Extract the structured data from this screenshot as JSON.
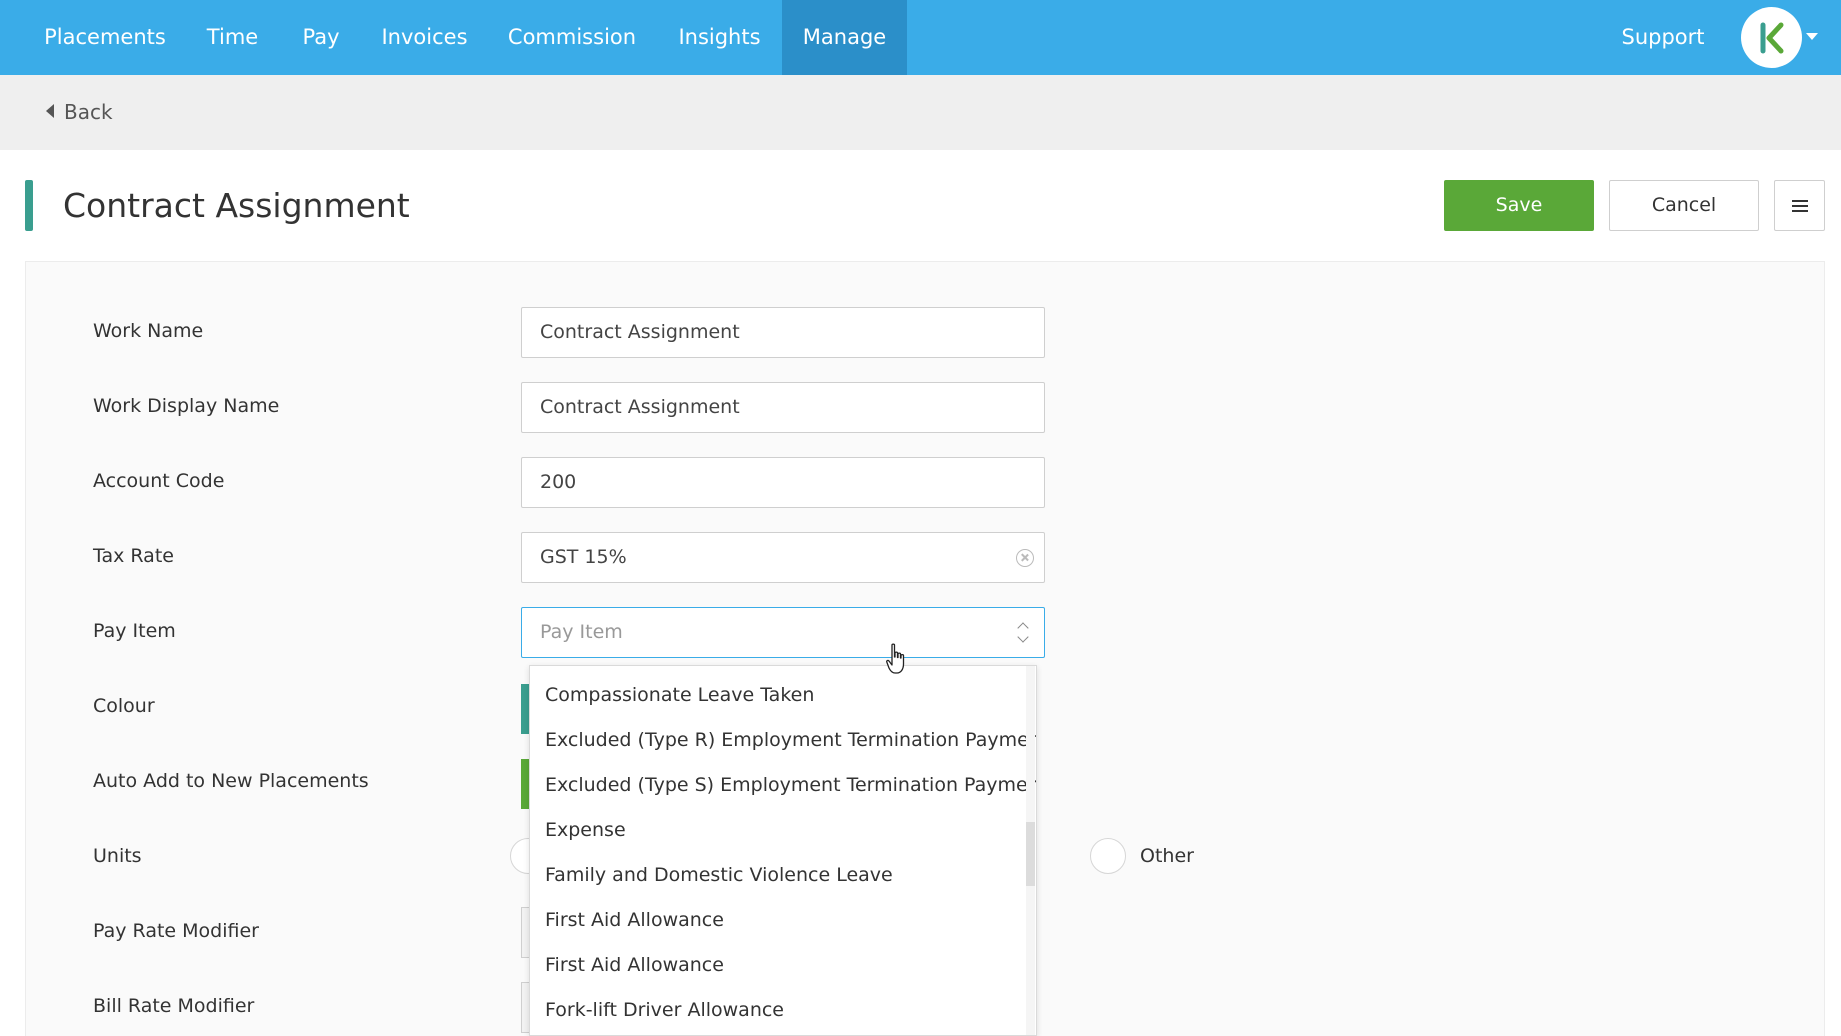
{
  "nav": {
    "items": [
      {
        "label": "Placements"
      },
      {
        "label": "Time"
      },
      {
        "label": "Pay"
      },
      {
        "label": "Invoices"
      },
      {
        "label": "Commission"
      },
      {
        "label": "Insights"
      },
      {
        "label": "Manage",
        "active": true
      }
    ],
    "support_label": "Support",
    "brand_color": "#3aace8",
    "active_color": "#2b8fc9"
  },
  "subbar": {
    "back_label": "Back"
  },
  "header": {
    "title": "Contract Assignment",
    "save_label": "Save",
    "cancel_label": "Cancel"
  },
  "form": {
    "work_name": {
      "label": "Work Name",
      "value": "Contract Assignment"
    },
    "work_display_name": {
      "label": "Work Display Name",
      "value": "Contract Assignment"
    },
    "account_code": {
      "label": "Account Code",
      "value": "200"
    },
    "tax_rate": {
      "label": "Tax Rate",
      "value": "GST 15%"
    },
    "pay_item": {
      "label": "Pay Item",
      "placeholder": "Pay Item",
      "value": ""
    },
    "colour": {
      "label": "Colour",
      "value_color": "#3a9e8f"
    },
    "auto_add": {
      "label": "Auto Add to New Placements",
      "value_color": "#5aa838"
    },
    "units": {
      "label": "Units",
      "option_other": "Other"
    },
    "pay_rate_modifier": {
      "label": "Pay Rate Modifier"
    },
    "bill_rate_modifier": {
      "label": "Bill Rate Modifier"
    }
  },
  "dropdown": {
    "items": [
      "Compassionate Leave Taken",
      "Excluded (Type R) Employment Termination Payment",
      "Excluded (Type S) Employment Termination Payment",
      "Expense",
      "Family and Domestic Violence Leave",
      "First Aid Allowance",
      "First Aid Allowance",
      "Fork-lift Driver Allowance"
    ]
  },
  "colors": {
    "save": "#5aa838",
    "accent": "#3a9e8f"
  }
}
